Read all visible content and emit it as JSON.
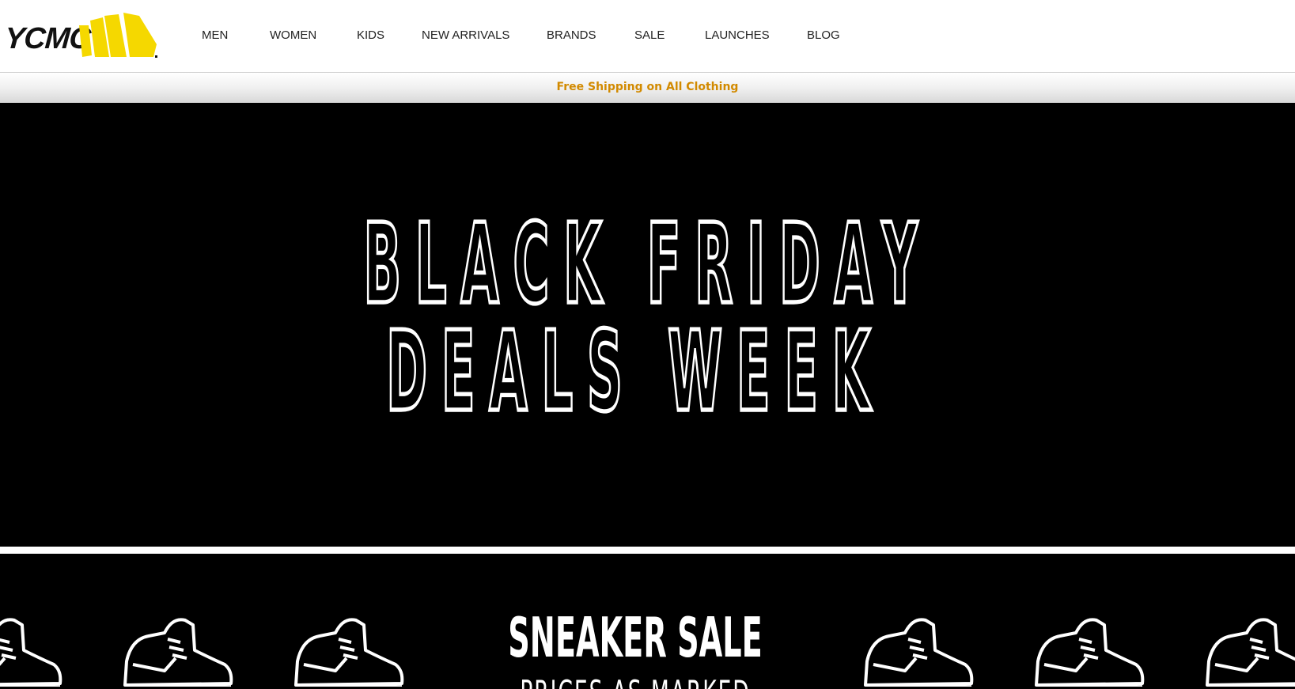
{
  "brand": {
    "name": "YCMC",
    "logo_color": "#f5d800"
  },
  "nav": {
    "items": [
      {
        "label": "MEN"
      },
      {
        "label": "WOMEN"
      },
      {
        "label": "KIDS"
      },
      {
        "label": "NEW ARRIVALS"
      },
      {
        "label": "BRANDS"
      },
      {
        "label": "SALE"
      },
      {
        "label": "LAUNCHES"
      },
      {
        "label": "BLOG"
      }
    ]
  },
  "promo_bar": {
    "text": "Free Shipping on All Clothing",
    "color": "#d28a00"
  },
  "hero": {
    "line1": "BLACK FRIDAY",
    "line2": "DEALS WEEK",
    "background": "#000000",
    "text_style": "white outline"
  },
  "sneaker_banner": {
    "title": "SNEAKER SALE",
    "subtitle": "PRICES AS MARKED",
    "icon": "sneaker-outline-icon"
  }
}
